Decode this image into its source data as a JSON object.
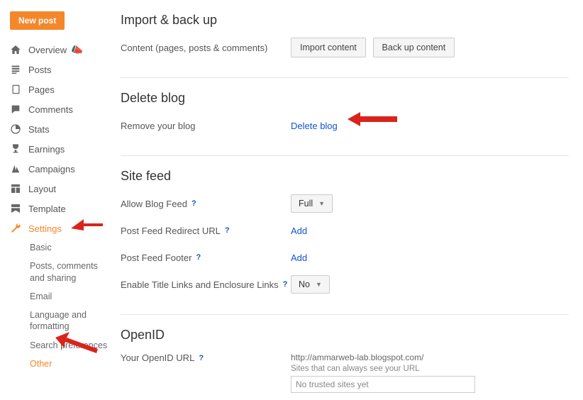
{
  "sidebar": {
    "new_post": "New post",
    "items": [
      {
        "label": "Overview"
      },
      {
        "label": "Posts"
      },
      {
        "label": "Pages"
      },
      {
        "label": "Comments"
      },
      {
        "label": "Stats"
      },
      {
        "label": "Earnings"
      },
      {
        "label": "Campaigns"
      },
      {
        "label": "Layout"
      },
      {
        "label": "Template"
      },
      {
        "label": "Settings"
      }
    ],
    "settings_sub": [
      {
        "label": "Basic"
      },
      {
        "label": "Posts, comments and sharing"
      },
      {
        "label": "Email"
      },
      {
        "label": "Language and formatting"
      },
      {
        "label": "Search preferences"
      },
      {
        "label": "Other"
      }
    ]
  },
  "sections": {
    "import": {
      "title": "Import & back up",
      "desc": "Content (pages, posts & comments)",
      "btn_import": "Import content",
      "btn_backup": "Back up content"
    },
    "delete": {
      "title": "Delete blog",
      "desc": "Remove your blog",
      "link": "Delete blog"
    },
    "feed": {
      "title": "Site feed",
      "allow_label": "Allow Blog Feed",
      "allow_value": "Full",
      "redirect_label": "Post Feed Redirect URL",
      "redirect_link": "Add",
      "footer_label": "Post Feed Footer",
      "footer_link": "Add",
      "enclosure_label": "Enable Title Links and Enclosure Links",
      "enclosure_value": "No"
    },
    "openid": {
      "title": "OpenID",
      "label": "Your OpenID URL",
      "url": "http://ammarweb-lab.blogspot.com/",
      "sub": "Sites that can always see your URL",
      "box": "No trusted sites yet"
    }
  },
  "help": "?"
}
